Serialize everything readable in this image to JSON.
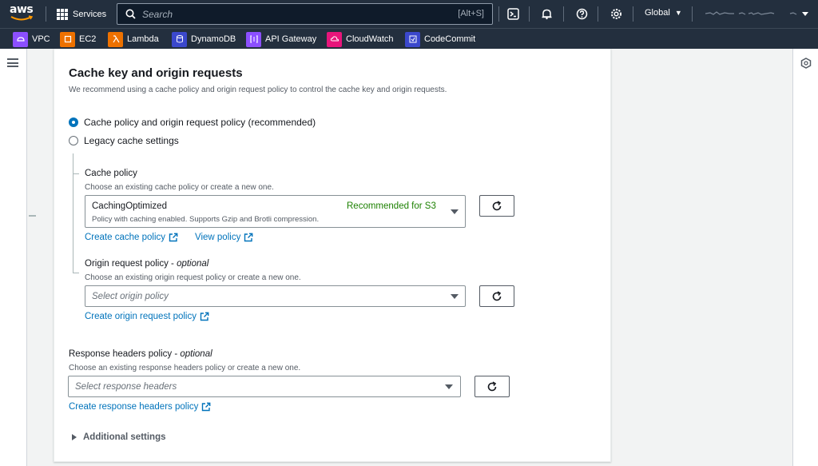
{
  "nav": {
    "logo": "aws",
    "services": "Services",
    "search_placeholder": "Search",
    "search_shortcut": "[Alt+S]",
    "region": "Global",
    "icons": [
      "cloudshell-icon",
      "notifications-icon",
      "help-icon",
      "settings-icon"
    ]
  },
  "favorites": [
    {
      "label": "VPC",
      "color": "#8c4fff"
    },
    {
      "label": "EC2",
      "color": "#ed7100"
    },
    {
      "label": "Lambda",
      "color": "#ed7100"
    },
    {
      "label": "DynamoDB",
      "color": "#3b48cc"
    },
    {
      "label": "API Gateway",
      "color": "#8c4fff"
    },
    {
      "label": "CloudWatch",
      "color": "#e7157b"
    },
    {
      "label": "CodeCommit",
      "color": "#3b48cc"
    }
  ],
  "section": {
    "title": "Cache key and origin requests",
    "description": "We recommend using a cache policy and origin request policy to control the cache key and origin requests.",
    "radio_recommended": "Cache policy and origin request policy (recommended)",
    "radio_legacy": "Legacy cache settings"
  },
  "cache_policy": {
    "label": "Cache policy",
    "description": "Choose an existing cache policy or create a new one.",
    "selected": "CachingOptimized",
    "selected_desc": "Policy with caching enabled. Supports Gzip and Brotli compression.",
    "badge": "Recommended for S3",
    "create_link": "Create cache policy",
    "view_link": "View policy"
  },
  "origin_policy": {
    "label": "Origin request policy",
    "optional": "optional",
    "description": "Choose an existing origin request policy or create a new one.",
    "placeholder": "Select origin policy",
    "create_link": "Create origin request policy"
  },
  "response_policy": {
    "label": "Response headers policy",
    "optional": "optional",
    "description": "Choose an existing response headers policy or create a new one.",
    "placeholder": "Select response headers",
    "create_link": "Create response headers policy"
  },
  "additional": "Additional settings",
  "colors": {
    "nav_bg": "#232f3e",
    "link": "#0073bb",
    "radio": "#0073bb",
    "success": "#1d8102"
  }
}
